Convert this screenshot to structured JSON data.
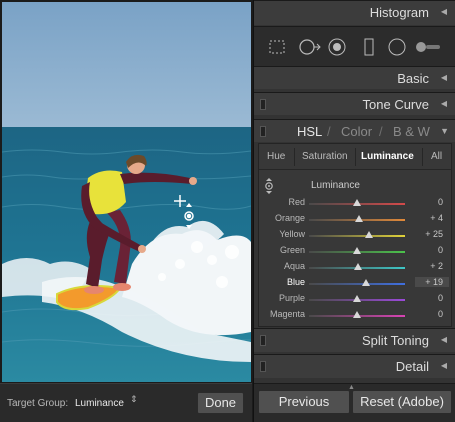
{
  "photo": {
    "sky_color": "#6b93b8",
    "water_color": "#1f6f8f",
    "cursor": "target-adjust-cursor"
  },
  "target_bar": {
    "label": "Target Group:",
    "value": "Luminance",
    "caret": "⇕",
    "done_label": "Done"
  },
  "panels": {
    "histogram": "Histogram",
    "basic": "Basic",
    "tone_curve": "Tone Curve",
    "split_toning": "Split Toning",
    "detail": "Detail",
    "collapse_triangle": "◀",
    "expand_triangle": "▼"
  },
  "hsl": {
    "heading": [
      "HSL",
      "Color",
      "B & W"
    ],
    "separator": "/",
    "tabs": [
      "Hue",
      "Saturation",
      "Luminance",
      "All"
    ],
    "active_tab": "Luminance",
    "section_title": "Luminance",
    "sliders": [
      {
        "name": "Red",
        "value": "0",
        "amount": 0,
        "color": "#d44a4a"
      },
      {
        "name": "Orange",
        "value": "+ 4",
        "amount": 4,
        "color": "#e0893a"
      },
      {
        "name": "Yellow",
        "value": "+ 25",
        "amount": 25,
        "color": "#e0d23a"
      },
      {
        "name": "Green",
        "value": "0",
        "amount": 0,
        "color": "#4bc24b"
      },
      {
        "name": "Aqua",
        "value": "+ 2",
        "amount": 2,
        "color": "#3ec7c7"
      },
      {
        "name": "Blue",
        "value": "+ 19",
        "amount": 19,
        "color": "#3f6fe0"
      },
      {
        "name": "Purple",
        "value": "0",
        "amount": 0,
        "color": "#9a4ad8"
      },
      {
        "name": "Magenta",
        "value": "0",
        "amount": 0,
        "color": "#d843b4"
      }
    ],
    "highlighted_slider": "Blue"
  },
  "footer": {
    "previous_label": "Previous",
    "reset_label": "Reset (Adobe)"
  },
  "colors": {
    "panel_bg": "#333333",
    "header_bg": "#3c3c3c",
    "button_bg": "#505050"
  }
}
